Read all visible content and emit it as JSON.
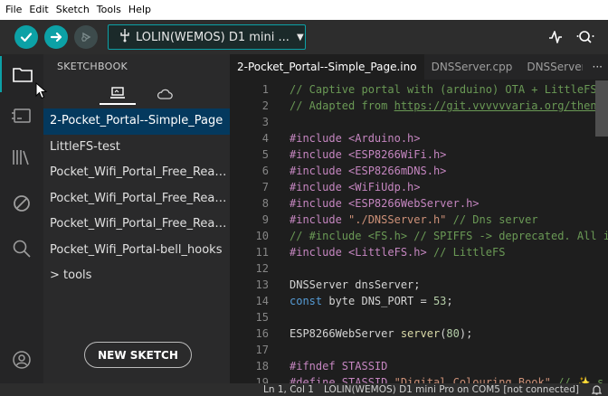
{
  "menubar": {
    "items": [
      "File",
      "Edit",
      "Sketch",
      "Tools",
      "Help"
    ]
  },
  "toolbar": {
    "board": "LOLIN(WEMOS) D1 mini ...",
    "icons": [
      "verify-icon",
      "upload-icon",
      "debug-icon",
      "serial-plotter-icon",
      "serial-monitor-icon"
    ]
  },
  "activity": {
    "icons": [
      "folder-icon",
      "board-manager-icon",
      "library-icon",
      "debug-icon",
      "search-icon",
      "account-icon"
    ]
  },
  "sidebar": {
    "title": "SKETCHBOOK",
    "tabs": [
      "local-sketchbook-icon",
      "cloud-icon"
    ],
    "items": [
      "2-Pocket_Portal--Simple_Page",
      "LittleFS-test",
      "Pocket_Wifi_Portal_Free_Readi...",
      "Pocket_Wifi_Portal_Free_Readi...",
      "Pocket_Wifi_Portal_Free_Readi...",
      "Pocket_Wifi_Portal-bell_hooks",
      "> tools"
    ],
    "new_sketch": "NEW SKETCH"
  },
  "editor": {
    "tabs": [
      "2-Pocket_Portal--Simple_Page.ino",
      "DNSServer.cpp",
      "DNSServer."
    ],
    "more": "···",
    "lines": [
      {
        "n": "1",
        "parts": [
          {
            "c": "c-com",
            "t": "// Captive portal with (arduino) OTA + LittleFS"
          }
        ]
      },
      {
        "n": "2",
        "parts": [
          {
            "c": "c-com",
            "t": "// Adapted from "
          },
          {
            "c": "c-com c-url",
            "t": "https://git.vvvvvvaria.org/then/"
          }
        ]
      },
      {
        "n": "3",
        "parts": []
      },
      {
        "n": "4",
        "parts": [
          {
            "c": "c-pre",
            "t": "#include <Arduino.h>"
          }
        ]
      },
      {
        "n": "5",
        "parts": [
          {
            "c": "c-pre",
            "t": "#include <ESP8266WiFi.h>"
          }
        ]
      },
      {
        "n": "6",
        "parts": [
          {
            "c": "c-pre",
            "t": "#include <ESP8266mDNS.h>"
          }
        ]
      },
      {
        "n": "7",
        "parts": [
          {
            "c": "c-pre",
            "t": "#include <WiFiUdp.h>"
          }
        ]
      },
      {
        "n": "8",
        "parts": [
          {
            "c": "c-pre",
            "t": "#include <ESP8266WebServer.h>"
          }
        ]
      },
      {
        "n": "9",
        "parts": [
          {
            "c": "c-pre",
            "t": "#include "
          },
          {
            "c": "c-str",
            "t": "\"./DNSServer.h\""
          },
          {
            "c": "c-com",
            "t": " // Dns server"
          }
        ]
      },
      {
        "n": "10",
        "parts": [
          {
            "c": "c-com",
            "t": "// #include <FS.h> // SPIFFS -> deprecated. All i"
          }
        ]
      },
      {
        "n": "11",
        "parts": [
          {
            "c": "c-pre",
            "t": "#include <LittleFS.h>"
          },
          {
            "c": "c-com",
            "t": " // LittleFS"
          }
        ]
      },
      {
        "n": "12",
        "parts": []
      },
      {
        "n": "13",
        "parts": [
          {
            "c": "",
            "t": "DNSServer dnsServer;"
          }
        ]
      },
      {
        "n": "14",
        "parts": [
          {
            "c": "c-kw",
            "t": "const"
          },
          {
            "c": "",
            "t": " byte DNS_PORT = "
          },
          {
            "c": "c-num",
            "t": "53"
          },
          {
            "c": "",
            "t": ";"
          }
        ]
      },
      {
        "n": "15",
        "parts": []
      },
      {
        "n": "16",
        "parts": [
          {
            "c": "",
            "t": "ESP8266WebServer "
          },
          {
            "c": "c-fn",
            "t": "server"
          },
          {
            "c": "",
            "t": "("
          },
          {
            "c": "c-num",
            "t": "80"
          },
          {
            "c": "",
            "t": ");"
          }
        ]
      },
      {
        "n": "17",
        "parts": []
      },
      {
        "n": "18",
        "parts": [
          {
            "c": "c-pre",
            "t": "#ifndef STASSID"
          }
        ]
      },
      {
        "n": "19",
        "parts": [
          {
            "c": "c-pre",
            "t": "#define STASSID "
          },
          {
            "c": "c-str",
            "t": "\"Digital Colouring Book\""
          },
          {
            "c": "c-com",
            "t": " // ✨ s"
          }
        ]
      }
    ]
  },
  "status": {
    "position": "Ln 1, Col 1",
    "board": "LOLIN(WEMOS) D1 mini Pro on COM5 [not connected]"
  }
}
